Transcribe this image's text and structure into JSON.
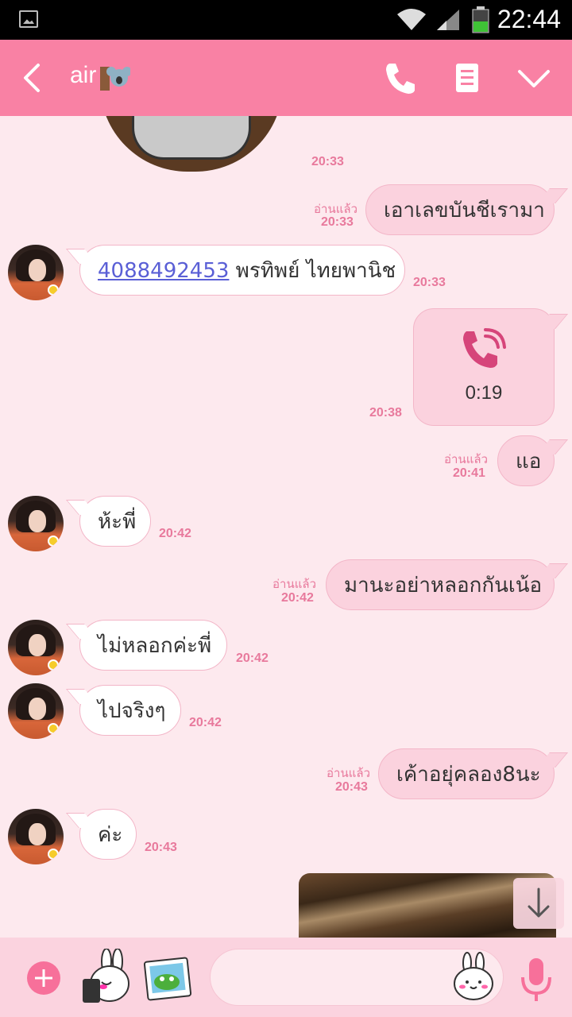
{
  "status_bar": {
    "time": "22:44"
  },
  "header": {
    "back_icon": "chevron-left-icon",
    "title": "air",
    "koala_icon": "koala-emoji-icon",
    "call_icon": "phone-icon",
    "notes_icon": "note-icon",
    "menu_icon": "chevron-down-icon"
  },
  "messages": [
    {
      "type": "sticker",
      "direction": "incoming",
      "time": "20:33"
    },
    {
      "direction": "outgoing",
      "read": "อ่านแล้ว",
      "time": "20:33",
      "text": "เอาเลขบันชีเรามา"
    },
    {
      "direction": "incoming",
      "time": "20:33",
      "link": "4088492453",
      "text": " พรทิพย์ ไทยพานิช"
    },
    {
      "type": "call",
      "direction": "outgoing",
      "time": "20:38",
      "duration": "0:19"
    },
    {
      "direction": "outgoing",
      "read": "อ่านแล้ว",
      "time": "20:41",
      "text": "แอ"
    },
    {
      "direction": "incoming",
      "time": "20:42",
      "text": "ห้ะพี่"
    },
    {
      "direction": "outgoing",
      "read": "อ่านแล้ว",
      "time": "20:42",
      "text": "มานะอย่าหลอกกันเน้อ"
    },
    {
      "direction": "incoming",
      "time": "20:42",
      "text": "ไม่หลอกค่ะพี่"
    },
    {
      "direction": "incoming",
      "time": "20:42",
      "text": "ไปจริงๆ"
    },
    {
      "direction": "outgoing",
      "read": "อ่านแล้ว",
      "time": "20:43",
      "text": "เค้าอยุ่คลอง8นะ"
    },
    {
      "direction": "incoming",
      "time": "20:43",
      "text": "ค่ะ"
    },
    {
      "type": "photo",
      "direction": "outgoing"
    }
  ],
  "input_bar": {
    "placeholder": "",
    "plus_icon": "plus-icon",
    "sticker_icon": "sticker-icon",
    "photo_icon": "photo-icon",
    "emoji_icon": "emoji-icon",
    "mic_icon": "mic-icon"
  },
  "colors": {
    "header": "#f981a4",
    "background": "#fde9ee",
    "outgoing_bubble": "#fbd2de",
    "accent": "#f7709a"
  }
}
